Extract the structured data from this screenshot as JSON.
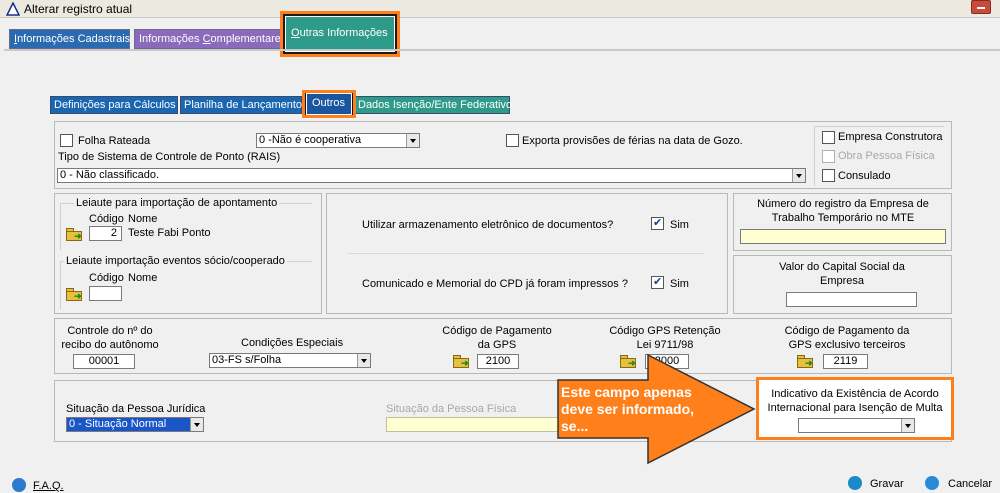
{
  "window": {
    "title": "Alterar registro atual"
  },
  "tabs": {
    "cadastrais": {
      "pre": "",
      "u": "I",
      "post": "nformações Cadastrais"
    },
    "complementares": {
      "pre": "Informações ",
      "u": "C",
      "post": "omplementares"
    },
    "outras": {
      "pre": "",
      "u": "O",
      "post": "utras Informações"
    }
  },
  "subtabs": {
    "calculos": "Definições para Cálculos",
    "planilha": "Planilha de Lançamentos",
    "outros": "Outros",
    "isencao": "Dados Isenção/Ente Federativo"
  },
  "section1": {
    "folha_rateada": "Folha Rateada",
    "cooperativa_value": "0 -Não é cooperativa",
    "exporta_provisoes": "Exporta provisões de férias na data de Gozo.",
    "tipo_sistema_label": "Tipo de Sistema de Controle de Ponto (RAIS)",
    "tipo_sistema_value": "0 - Não classificado.",
    "empresa_construtora": "Empresa Construtora",
    "obra_pessoa_fisica": "Obra Pessoa Física",
    "consulado": "Consulado"
  },
  "leiaute1": {
    "title": "Leiaute para importação de apontamento",
    "codigo_label": "Código",
    "nome_label": "Nome",
    "codigo_value": "2",
    "nome_value": "Teste Fabi Ponto"
  },
  "leiaute2": {
    "title": "Leiaute importação eventos sócio/cooperado",
    "codigo_label": "Código",
    "nome_label": "Nome",
    "codigo_value": ""
  },
  "middle": {
    "armazenamento": "Utilizar armazenamento eletrônico de documentos?",
    "armazenamento_check": "Sim",
    "comunicado": "Comunicado e Memorial do CPD já foram impressos ?",
    "comunicado_check": "Sim"
  },
  "right": {
    "numero_registro": "Número do registro da Empresa de Trabalho Temporário no MTE",
    "numero_registro_value": "",
    "capital_social": "Valor do Capital Social da Empresa",
    "capital_social_value": ""
  },
  "row3": {
    "controle_label": "Controle do nº do recibo do autônomo",
    "controle_value": "00001",
    "condicoes_label": "Condições Especiais",
    "condicoes_value": "03-FS s/Folha",
    "gps_label": "Código de Pagamento da GPS",
    "gps_value": "2100",
    "gps_retencao_label": "Código GPS Retenção Lei 9711/98",
    "gps_retencao_value": "2000",
    "gps_terceiros_label": "Código de Pagamento da GPS exclusivo terceiros",
    "gps_terceiros_value": "2119"
  },
  "row4": {
    "situacao_pj_label": "Situação da Pessoa Jurídica",
    "situacao_pj_value": "0 - Situação Normal",
    "situacao_pf_label": "Situação da Pessoa Física",
    "situacao_pf_value": "",
    "indicativo_label": "Indicativo da Existência de Acordo Internacional para Isenção de Multa",
    "indicativo_value": ""
  },
  "callout": {
    "text": "Este campo apenas deve ser informado, se...",
    "color": "#ff7f1a"
  },
  "footer": {
    "faq": "F.A.Q.",
    "gravar": "Gravar",
    "cancelar": "Cancelar"
  },
  "colors": {
    "highlight": "#ff7f1a",
    "field_yellow": "#ffffd2",
    "selection_blue": "#1a56c8"
  }
}
